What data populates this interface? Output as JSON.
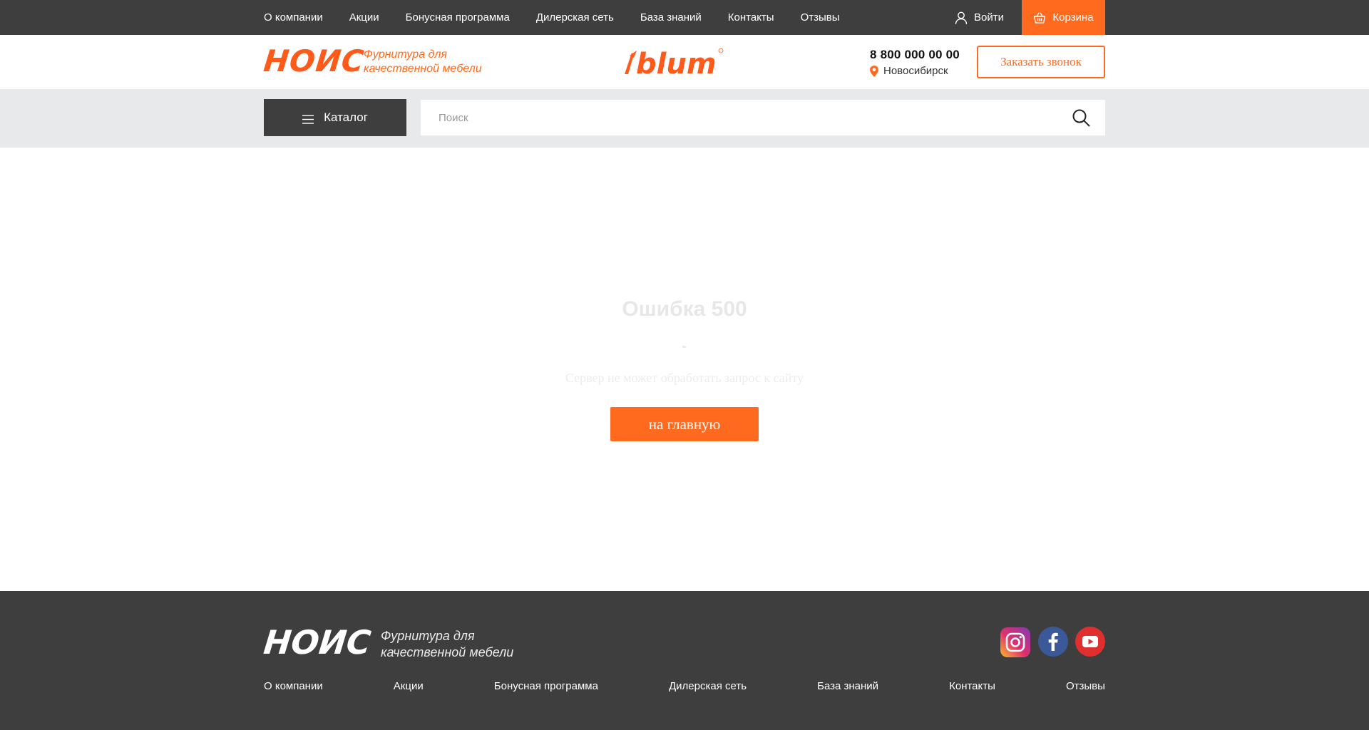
{
  "top_nav": {
    "items": [
      {
        "label": "О компании"
      },
      {
        "label": "Акции"
      },
      {
        "label": "Бонусная программа"
      },
      {
        "label": "Дилерская сеть"
      },
      {
        "label": "База знаний"
      },
      {
        "label": "Контакты"
      },
      {
        "label": "Отзывы"
      }
    ],
    "login_label": "Войти",
    "login_icon": "user-icon",
    "cart_label": "Корзина",
    "cart_icon": "basket-icon"
  },
  "header": {
    "logo_text": "НОИС",
    "tagline_line1": "Фурнитура для",
    "tagline_line2": "качественной мебели",
    "partner_logo": "blum",
    "phone": "8 800 000 00 00",
    "city": "Новосибирск",
    "city_icon": "location-pin-icon",
    "callback_label": "Заказать звонок"
  },
  "catalog_bar": {
    "catalog_label": "Каталог",
    "catalog_icon": "menu-icon",
    "search_placeholder": "Поиск",
    "search_icon": "search-icon"
  },
  "error": {
    "title": "Ошибка 500",
    "message": "Сервер не может обработать запрос к сайту",
    "home_button": "на главную"
  },
  "footer": {
    "logo_text": "НОИС",
    "tagline_line1": "Фурнитура для",
    "tagline_line2": "качественной мебели",
    "social": [
      {
        "icon": "instagram-icon"
      },
      {
        "icon": "facebook-icon"
      },
      {
        "icon": "youtube-icon"
      }
    ],
    "nav": [
      {
        "label": "О компании"
      },
      {
        "label": "Акции"
      },
      {
        "label": "Бонусная программа"
      },
      {
        "label": "Дилерская сеть"
      },
      {
        "label": "База знаний"
      },
      {
        "label": "Контакты"
      },
      {
        "label": "Отзывы"
      }
    ]
  },
  "colors": {
    "accent": "#ff6a1e",
    "dark": "#3e3e3e",
    "strip": "#e8e9eb"
  }
}
